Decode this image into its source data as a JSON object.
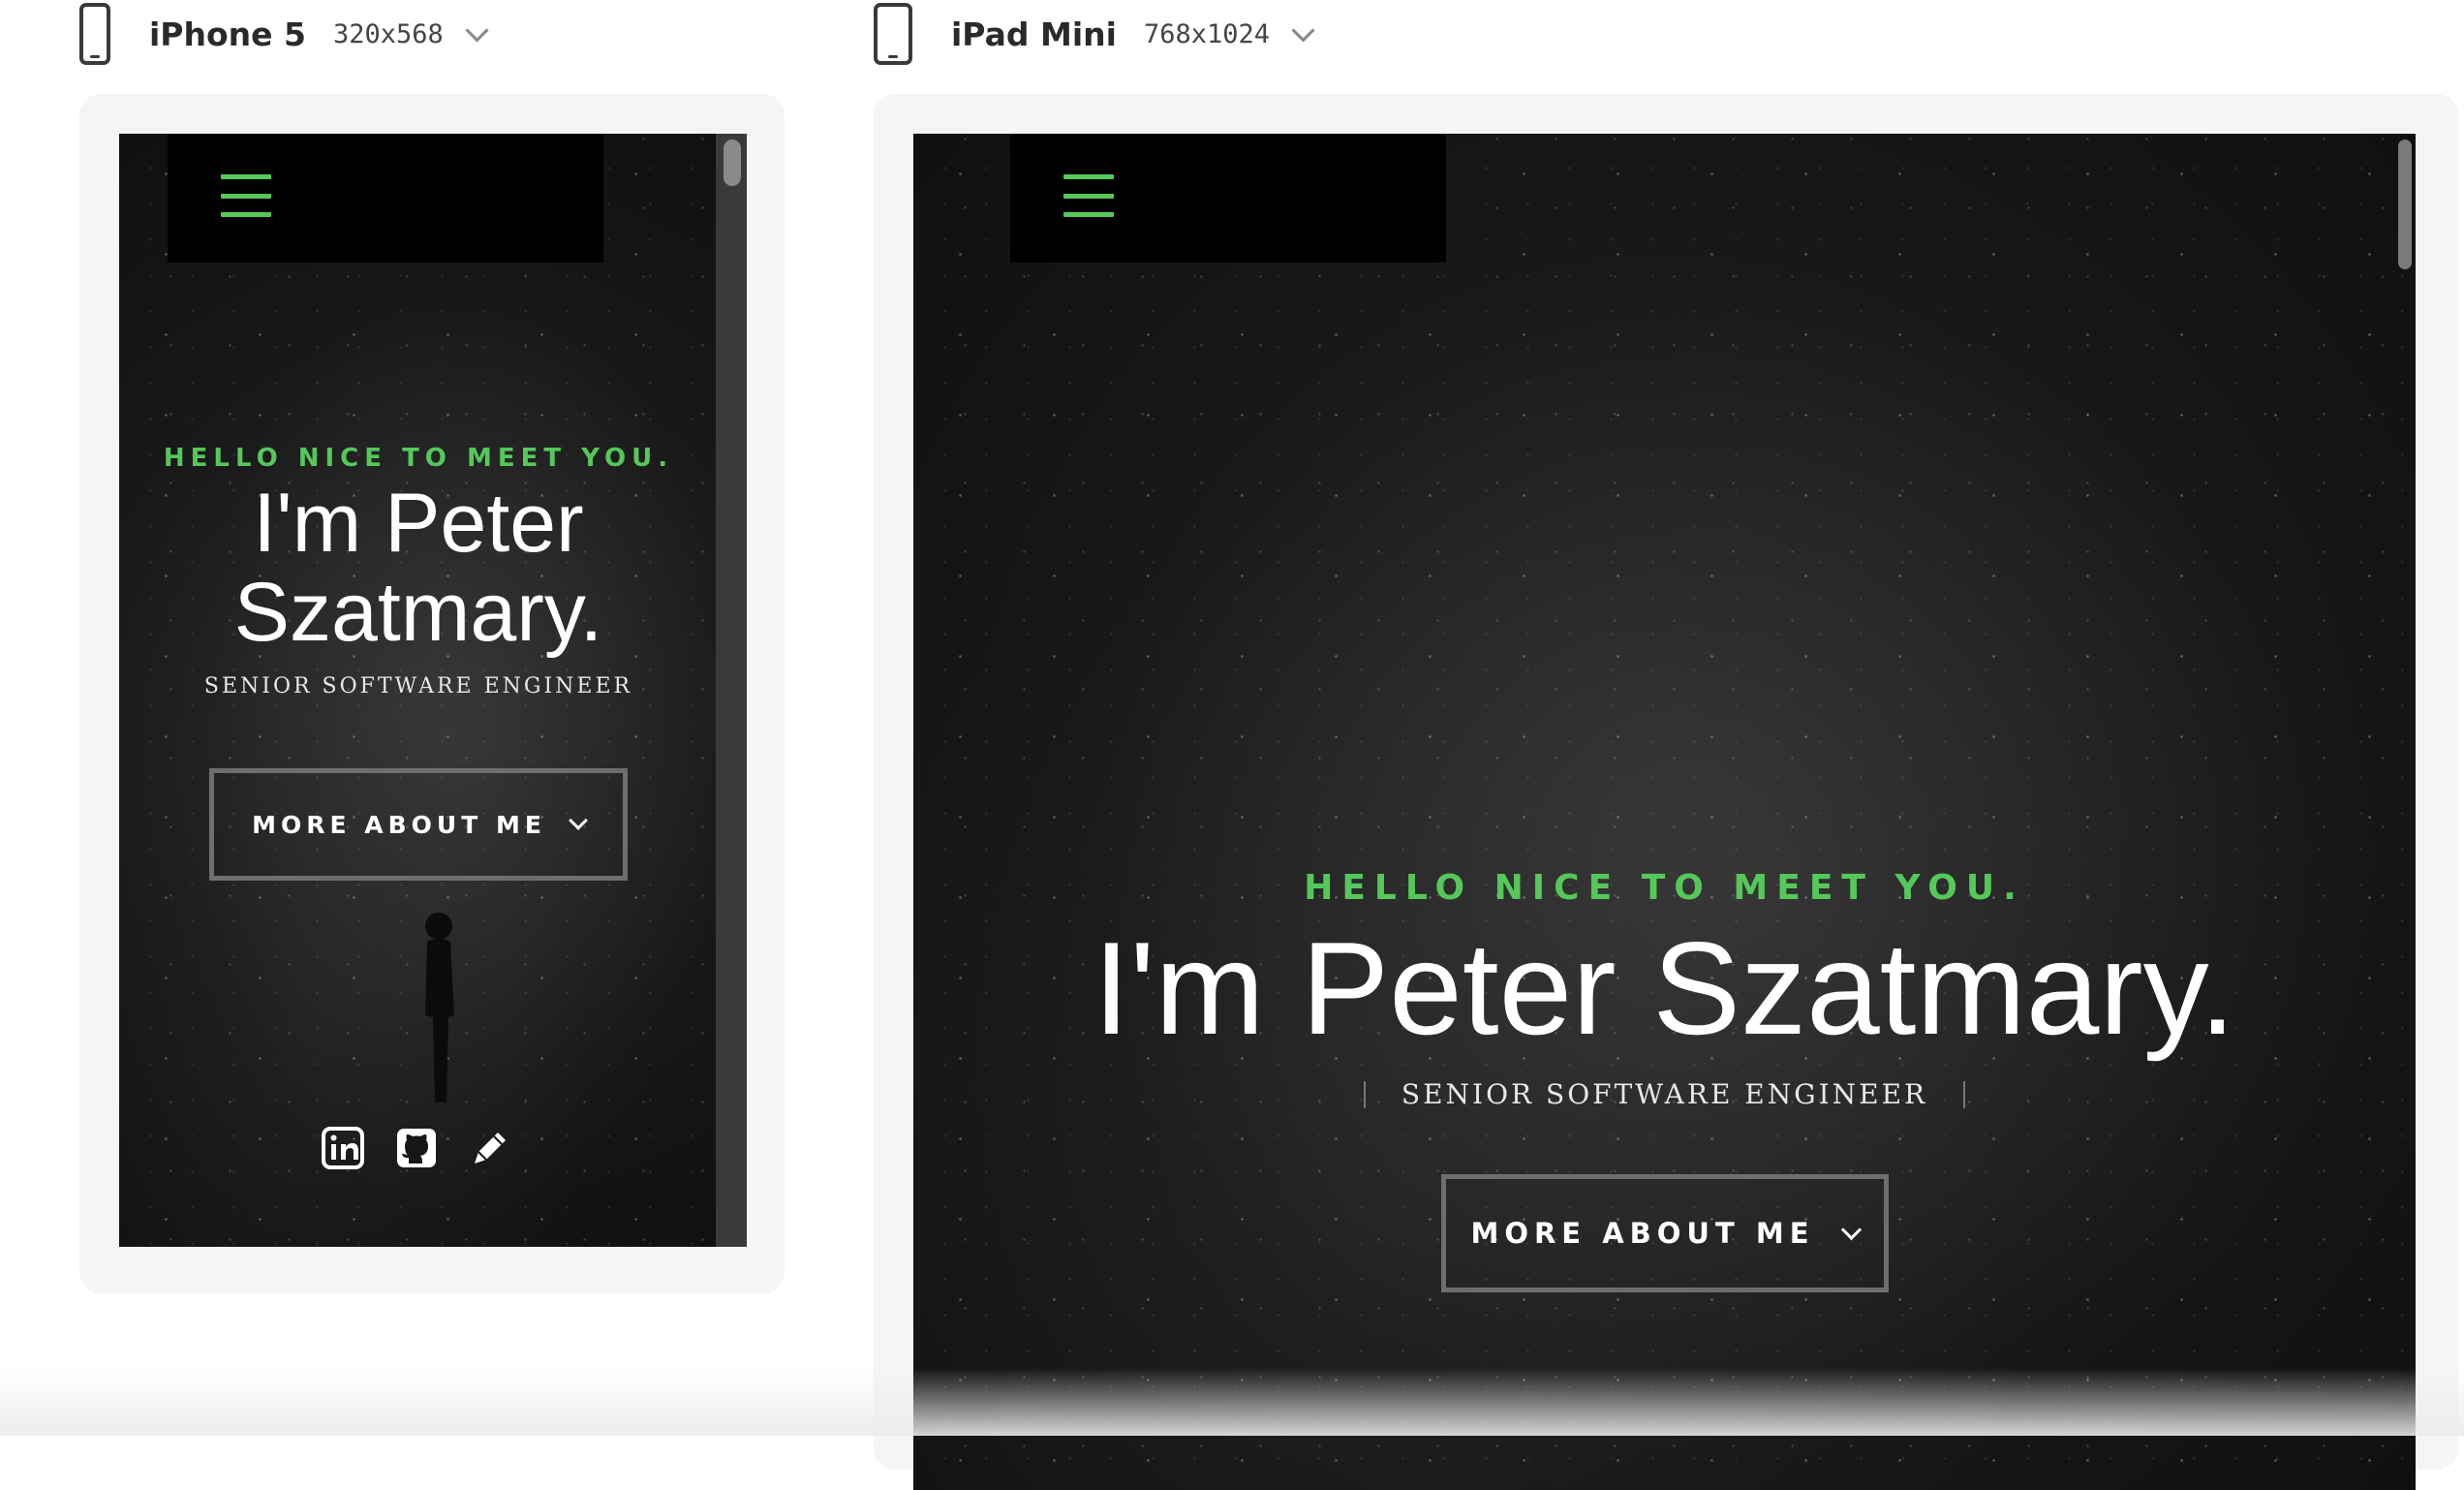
{
  "devices": [
    {
      "name": "iPhone 5",
      "size": "320x568",
      "site": {
        "greeting": "HELLO NICE TO MEET YOU.",
        "name_line1": "I'm Peter",
        "name_line2": "Szatmary.",
        "role": "SENIOR SOFTWARE ENGINEER",
        "cta": "MORE ABOUT ME",
        "social_icons": [
          "linkedin-icon",
          "github-icon",
          "pencil-icon"
        ]
      }
    },
    {
      "name": "iPad Mini",
      "size": "768x1024",
      "site": {
        "greeting": "HELLO NICE TO MEET YOU.",
        "name": "I'm Peter Szatmary.",
        "role": "SENIOR SOFTWARE ENGINEER",
        "cta": "MORE ABOUT ME"
      }
    }
  ],
  "colors": {
    "accent_green": "#55c85a",
    "hero_bg": "#161616",
    "nav_bg": "#000000",
    "frame_bg": "#f4f5f5"
  }
}
